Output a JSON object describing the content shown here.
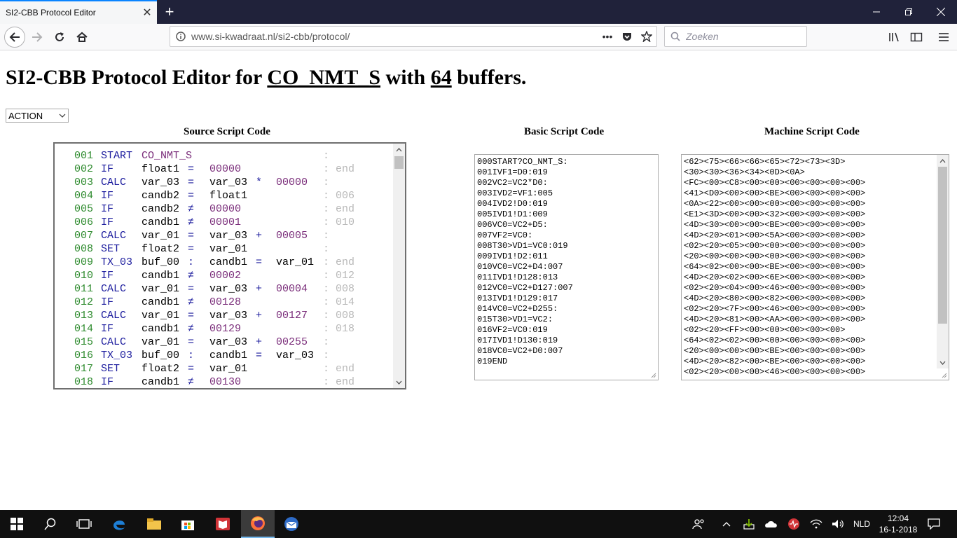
{
  "browser": {
    "tab_title": "SI2-CBB Protocol Editor",
    "url": "www.si-kwadraat.nl/si2-cbb/protocol/",
    "search_placeholder": "Zoeken"
  },
  "page": {
    "title_prefix": "SI2-CBB Protocol Editor for ",
    "title_protocol": "CO_NMT_S",
    "title_mid": " with ",
    "title_buffers": "64",
    "title_suffix": " buffers.",
    "action_select": "ACTION",
    "headings": {
      "source": "Source Script Code",
      "basic": "Basic Script Code",
      "machine": "Machine Script Code"
    }
  },
  "source_lines": [
    {
      "num": "001",
      "kw": "START",
      "a": "CO_NMT_S",
      "b": "",
      "c": "",
      "d": "",
      "e": "",
      "ann": ":"
    },
    {
      "num": "002",
      "kw": "IF",
      "a": "float1",
      "b": "=",
      "c": "00000",
      "d": "",
      "e": "",
      "ann": ": end"
    },
    {
      "num": "003",
      "kw": "CALC",
      "a": "var_03",
      "b": "=",
      "c": "var_03",
      "d": "*",
      "e": "00000",
      "ann": ":"
    },
    {
      "num": "004",
      "kw": "IF",
      "a": "candb2",
      "b": "=",
      "c": "float1",
      "d": "",
      "e": "",
      "ann": ": 006"
    },
    {
      "num": "005",
      "kw": "IF",
      "a": "candb2",
      "b": "≠",
      "c": "00000",
      "d": "",
      "e": "",
      "ann": ": end"
    },
    {
      "num": "006",
      "kw": "IF",
      "a": "candb1",
      "b": "≠",
      "c": "00001",
      "d": "",
      "e": "",
      "ann": ": 010"
    },
    {
      "num": "007",
      "kw": "CALC",
      "a": "var_01",
      "b": "=",
      "c": "var_03",
      "d": "+",
      "e": "00005",
      "ann": ":"
    },
    {
      "num": "008",
      "kw": "SET",
      "a": "float2",
      "b": "=",
      "c": "var_01",
      "d": "",
      "e": "",
      "ann": ":"
    },
    {
      "num": "009",
      "kw": "TX_03",
      "a": "buf_00",
      "b": ":",
      "c": "candb1",
      "d": "=",
      "e": "var_01",
      "ann": ": end"
    },
    {
      "num": "010",
      "kw": "IF",
      "a": "candb1",
      "b": "≠",
      "c": "00002",
      "d": "",
      "e": "",
      "ann": ": 012"
    },
    {
      "num": "011",
      "kw": "CALC",
      "a": "var_01",
      "b": "=",
      "c": "var_03",
      "d": "+",
      "e": "00004",
      "ann": ": 008"
    },
    {
      "num": "012",
      "kw": "IF",
      "a": "candb1",
      "b": "≠",
      "c": "00128",
      "d": "",
      "e": "",
      "ann": ": 014"
    },
    {
      "num": "013",
      "kw": "CALC",
      "a": "var_01",
      "b": "=",
      "c": "var_03",
      "d": "+",
      "e": "00127",
      "ann": ": 008"
    },
    {
      "num": "014",
      "kw": "IF",
      "a": "candb1",
      "b": "≠",
      "c": "00129",
      "d": "",
      "e": "",
      "ann": ": 018"
    },
    {
      "num": "015",
      "kw": "CALC",
      "a": "var_01",
      "b": "=",
      "c": "var_03",
      "d": "+",
      "e": "00255",
      "ann": ":"
    },
    {
      "num": "016",
      "kw": "TX_03",
      "a": "buf_00",
      "b": ":",
      "c": "candb1",
      "d": "=",
      "e": "var_03",
      "ann": ":"
    },
    {
      "num": "017",
      "kw": "SET",
      "a": "float2",
      "b": "=",
      "c": "var_01",
      "d": "",
      "e": "",
      "ann": ": end"
    },
    {
      "num": "018",
      "kw": "IF",
      "a": "candb1",
      "b": "≠",
      "c": "00130",
      "d": "",
      "e": "",
      "ann": ": end"
    }
  ],
  "basic_lines": [
    "000START?CO_NMT_S:",
    "001IVF1=D0:019",
    "002VC2=VC2*D0:",
    "003IVD2=VF1:005",
    "004IVD2!D0:019",
    "005IVD1!D1:009",
    "006VC0=VC2+D5:",
    "007VF2=VC0:",
    "008T30>VD1=VC0:019",
    "009IVD1!D2:011",
    "010VC0=VC2+D4:007",
    "011IVD1!D128:013",
    "012VC0=VC2+D127:007",
    "013IVD1!D129:017",
    "014VC0=VC2+D255:",
    "015T30>VD1=VC2:",
    "016VF2=VC0:019",
    "017IVD1!D130:019",
    "018VC0=VC2+D0:007",
    "019END"
  ],
  "machine_lines": [
    "<62><75><66><66><65><72><73><3D>",
    "<30><30><36><34><0D><0A>",
    "<FC><00><C8><00><00><00><00><00><00>",
    "<41><D0><00><00><BE><00><00><00><00>",
    "<0A><22><00><00><00><00><00><00><00>",
    "<E1><3D><00><00><32><00><00><00><00>",
    "<4D><30><00><00><BE><00><00><00><00>",
    "<4D><20><01><00><5A><00><00><00><00>",
    "<02><20><05><00><00><00><00><00><00>",
    "<20><00><00><00><00><00><00><00><00>",
    "<64><02><00><00><BE><00><00><00><00>",
    "<4D><20><02><00><6E><00><00><00><00>",
    "<02><20><04><00><46><00><00><00><00>",
    "<4D><20><80><00><82><00><00><00><00>",
    "<02><20><7F><00><46><00><00><00><00>",
    "<4D><20><81><00><AA><00><00><00><00>",
    "<02><20><FF><00><00><00><00><00>",
    "<64><02><02><00><00><00><00><00><00>",
    "<20><00><00><00><BE><00><00><00><00>",
    "<4D><20><82><00><BE><00><00><00><00>",
    "<02><20><00><00><46><00><00><00><00>"
  ],
  "taskbar": {
    "lang": "NLD",
    "time": "12:04",
    "date": "16-1-2018"
  }
}
